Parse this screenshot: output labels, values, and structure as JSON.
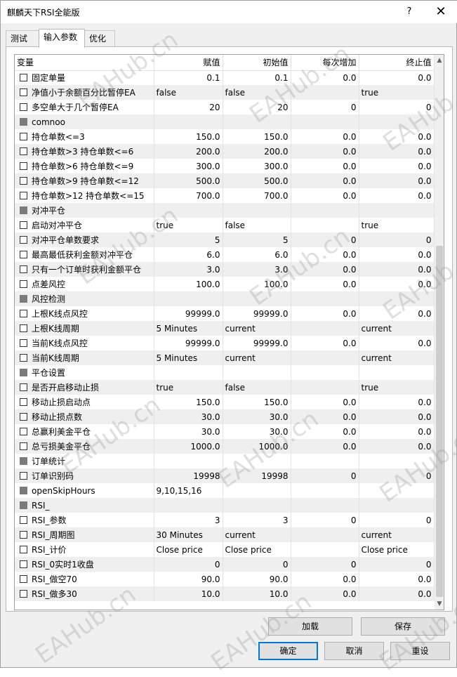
{
  "window": {
    "title": "麒麟天下RSI全能版",
    "help": "?",
    "close": "✕"
  },
  "tabs": [
    {
      "label": "测试"
    },
    {
      "label": "输入参数"
    },
    {
      "label": "优化"
    }
  ],
  "grid": {
    "headers": [
      "变量",
      "赋值",
      "初始值",
      "每次增加",
      "终止值"
    ],
    "rows": [
      {
        "kind": "param",
        "name": "固定单量",
        "value": "0.1",
        "start": "0.1",
        "step": "0.0",
        "stop": "0.0"
      },
      {
        "kind": "param",
        "name": "净值小于余额百分比暂停EA",
        "value": "false",
        "start": "false",
        "step": "",
        "stop": "true"
      },
      {
        "kind": "param",
        "name": "多空单大于几个暂停EA",
        "value": "20",
        "start": "20",
        "step": "0",
        "stop": "0"
      },
      {
        "kind": "group",
        "name": "comnoo",
        "value": "",
        "start": "",
        "step": "",
        "stop": ""
      },
      {
        "kind": "param",
        "name": "持仓单数<=3",
        "value": "150.0",
        "start": "150.0",
        "step": "0.0",
        "stop": "0.0"
      },
      {
        "kind": "param",
        "name": "持仓单数>3   持仓单数<=6",
        "value": "200.0",
        "start": "200.0",
        "step": "0.0",
        "stop": "0.0"
      },
      {
        "kind": "param",
        "name": "持仓单数>6   持仓单数<=9",
        "value": "300.0",
        "start": "300.0",
        "step": "0.0",
        "stop": "0.0"
      },
      {
        "kind": "param",
        "name": "持仓单数>9   持仓单数<=12",
        "value": "500.0",
        "start": "500.0",
        "step": "0.0",
        "stop": "0.0"
      },
      {
        "kind": "param",
        "name": "持仓单数>12  持仓单数<=15",
        "value": "700.0",
        "start": "700.0",
        "step": "0.0",
        "stop": "0.0"
      },
      {
        "kind": "group",
        "name": "对冲平仓",
        "value": "",
        "start": "",
        "step": "",
        "stop": ""
      },
      {
        "kind": "param",
        "name": "启动对冲平仓",
        "value": "true",
        "start": "false",
        "step": "",
        "stop": "true"
      },
      {
        "kind": "param",
        "name": "对冲平仓单数要求",
        "value": "5",
        "start": "5",
        "step": "0",
        "stop": "0"
      },
      {
        "kind": "param",
        "name": "最高最低获利金额对冲平仓",
        "value": "6.0",
        "start": "6.0",
        "step": "0.0",
        "stop": "0.0"
      },
      {
        "kind": "param",
        "name": "只有一个订单时获利金额平仓",
        "value": "3.0",
        "start": "3.0",
        "step": "0.0",
        "stop": "0.0"
      },
      {
        "kind": "param",
        "name": "点差风控",
        "value": "100.0",
        "start": "100.0",
        "step": "0.0",
        "stop": "0.0"
      },
      {
        "kind": "group",
        "name": "风控检测",
        "value": "",
        "start": "",
        "step": "",
        "stop": ""
      },
      {
        "kind": "param",
        "name": "上根K线点风控",
        "value": "99999.0",
        "start": "99999.0",
        "step": "0.0",
        "stop": "0.0"
      },
      {
        "kind": "param",
        "name": "上根K线周期",
        "value": "5 Minutes",
        "start": "current",
        "step": "",
        "stop": "current"
      },
      {
        "kind": "param",
        "name": "当前K线点风控",
        "value": "99999.0",
        "start": "99999.0",
        "step": "0.0",
        "stop": "0.0"
      },
      {
        "kind": "param",
        "name": "当前K线周期",
        "value": "5 Minutes",
        "start": "current",
        "step": "",
        "stop": "current"
      },
      {
        "kind": "group",
        "name": "平仓设置",
        "value": "",
        "start": "",
        "step": "",
        "stop": ""
      },
      {
        "kind": "param",
        "name": "是否开启移动止损",
        "value": "true",
        "start": "false",
        "step": "",
        "stop": "true"
      },
      {
        "kind": "param",
        "name": "移动止损启动点",
        "value": "150.0",
        "start": "150.0",
        "step": "0.0",
        "stop": "0.0"
      },
      {
        "kind": "param",
        "name": "移动止损点数",
        "value": "30.0",
        "start": "30.0",
        "step": "0.0",
        "stop": "0.0"
      },
      {
        "kind": "param",
        "name": "总赢利美金平仓",
        "value": "30.0",
        "start": "30.0",
        "step": "0.0",
        "stop": "0.0"
      },
      {
        "kind": "param",
        "name": "总亏损美金平仓",
        "value": "1000.0",
        "start": "1000.0",
        "step": "0.0",
        "stop": "0.0"
      },
      {
        "kind": "group",
        "name": "订单统计",
        "value": "",
        "start": "",
        "step": "",
        "stop": ""
      },
      {
        "kind": "param",
        "name": "订单识别码",
        "value": "19998",
        "start": "19998",
        "step": "0",
        "stop": "0"
      },
      {
        "kind": "group",
        "name": "openSkipHours",
        "value": "9,10,15,16",
        "start": "",
        "step": "",
        "stop": ""
      },
      {
        "kind": "group",
        "name": "RSI_",
        "value": "",
        "start": "",
        "step": "",
        "stop": ""
      },
      {
        "kind": "param",
        "name": "RSI_参数",
        "value": "3",
        "start": "3",
        "step": "0",
        "stop": "0"
      },
      {
        "kind": "param",
        "name": "RSI_周期图",
        "value": "30 Minutes",
        "start": "current",
        "step": "",
        "stop": "current"
      },
      {
        "kind": "param",
        "name": "RSI_计价",
        "value": "Close price",
        "start": "Close price",
        "step": "",
        "stop": "Close price"
      },
      {
        "kind": "param",
        "name": "RSI_0实时1收盘",
        "value": "0",
        "start": "0",
        "step": "0",
        "stop": "0"
      },
      {
        "kind": "param",
        "name": "RSI_做空70",
        "value": "90.0",
        "start": "90.0",
        "step": "0.0",
        "stop": "0.0"
      },
      {
        "kind": "param",
        "name": "RSI_做多30",
        "value": "10.0",
        "start": "10.0",
        "step": "0.0",
        "stop": "0.0"
      }
    ]
  },
  "buttons": {
    "load": "加载",
    "save": "保存",
    "ok": "确定",
    "cancel": "取消",
    "reset": "重设"
  },
  "watermark": "EAHub.cn"
}
